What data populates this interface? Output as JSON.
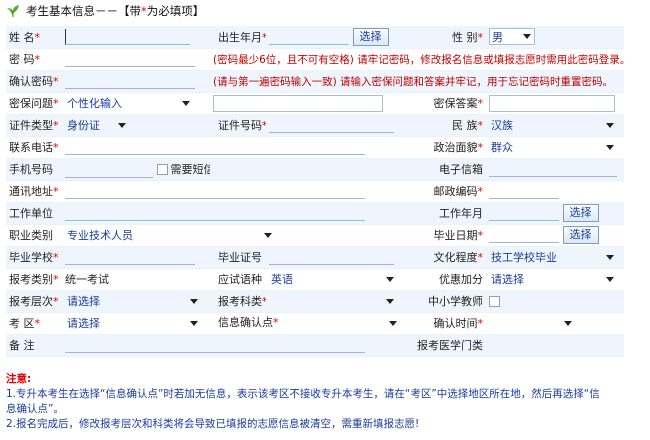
{
  "header": {
    "title_prefix": "考生基本信息－－【带",
    "title_star": "*",
    "title_suffix": "为必填项】"
  },
  "req": "*",
  "rows": {
    "name": {
      "label": "姓 名",
      "birth_label": "出生年月",
      "select_btn": "选择",
      "gender_label": "性 别",
      "gender_value": "男"
    },
    "pwd": {
      "label": "密 码",
      "hint": "(密码最少6位，且不可有空格) 请牢记密码，修改报名信息或填报志愿时需用此密码登录。"
    },
    "confirm": {
      "label": "确认密码",
      "hint": "(请与第一遍密码输入一致) 请输入密保问题和答案并牢记，用于忘记密码时重置密码。"
    },
    "question": {
      "label": "密保问题",
      "value": "个性化输入",
      "answer_label": "密保答案"
    },
    "id": {
      "type_label": "证件类型",
      "type_value": "身份证",
      "no_label": "证件号码",
      "ethnic_label": "民 族",
      "ethnic_value": "汉族"
    },
    "phone": {
      "label": "联系电话",
      "political_label": "政治面貌",
      "political_value": "群众"
    },
    "mobile": {
      "label": "手机号码",
      "sms_label": "需要短信服务",
      "email_label": "电子信箱"
    },
    "addr": {
      "label": "通讯地址",
      "zip_label": "邮政编码"
    },
    "work": {
      "label": "工作单位",
      "year_label": "工作年月",
      "select_btn": "选择"
    },
    "job": {
      "label": "职业类别",
      "value": "专业技术人员",
      "grad_date_label": "毕业日期",
      "select_btn": "选择"
    },
    "school": {
      "label": "毕业学校",
      "cert_label": "毕业证号",
      "edu_label": "文化程度",
      "edu_value": "技工学校毕业"
    },
    "exam": {
      "label": "报考类别",
      "value": "统一考试",
      "lang_label": "应试语种",
      "lang_value": "英语",
      "bonus_label": "优惠加分",
      "bonus_value": "请选择"
    },
    "level": {
      "label": "报考层次",
      "value": "请选择",
      "subject_label": "报考科类",
      "teacher_label": "中小学教师"
    },
    "area": {
      "label": "考 区",
      "value": "请选择",
      "confirm_point_label": "信息确认点",
      "confirm_time_label": "确认时间"
    },
    "remark": {
      "label": "备 注",
      "med_label": "报考医学门类"
    }
  },
  "notes": {
    "title": "注意:",
    "line1": "1.专升本考生在选择“信息确认点”时若加无信息，表示该考区不接收专升本考生，请在“考区”中选择地区所在地，然后再选择“信",
    "line1b": "息确认点”。",
    "line2": "2.报名完成后，修改报考层次和科类将会导致已填报的志愿信息被清空，需重新填报志愿!"
  },
  "colors": {
    "required": "#e60000",
    "hint": "#c00000",
    "link_blue": "#1a3c9c",
    "row_stripe": "#eef5fd"
  }
}
